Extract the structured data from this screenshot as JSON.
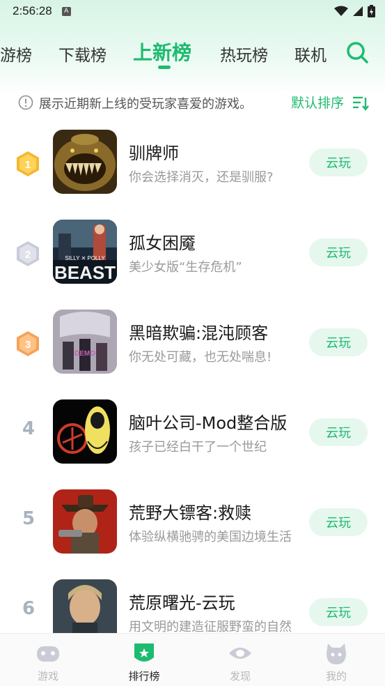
{
  "status_bar": {
    "time": "2:56:28",
    "notification_glyph": "A"
  },
  "tabs": [
    {
      "label": "游榜",
      "active": false
    },
    {
      "label": "下载榜",
      "active": false
    },
    {
      "label": "上新榜",
      "active": true
    },
    {
      "label": "热玩榜",
      "active": false
    },
    {
      "label": "联机",
      "active": false
    }
  ],
  "info": {
    "text": "展示近期新上线的受玩家喜爱的游戏。",
    "sort_label": "默认排序"
  },
  "games": [
    {
      "rank": "1",
      "title": "驯牌师",
      "desc": "你会选择消灭，还是驯服?",
      "button": "云玩",
      "medal": "gold"
    },
    {
      "rank": "2",
      "title": "孤女困魇",
      "desc": "美少女版“生存危机”",
      "button": "云玩",
      "medal": "silver"
    },
    {
      "rank": "3",
      "title": "黑暗欺骗:混沌顾客",
      "desc": "你无处可藏，也无处喘息!",
      "button": "云玩",
      "medal": "bronze"
    },
    {
      "rank": "4",
      "title": "脑叶公司-Mod整合版",
      "desc": "孩子已经白干了一个世纪",
      "button": "云玩",
      "medal": "none"
    },
    {
      "rank": "5",
      "title": "荒野大镖客:救赎",
      "desc": "体验纵横驰骋的美国边境生活",
      "button": "云玩",
      "medal": "none"
    },
    {
      "rank": "6",
      "title": "荒原曙光-云玩",
      "desc": "用文明的建造征服野蛮的自然",
      "button": "云玩",
      "medal": "none"
    }
  ],
  "thumb_text": {
    "beast_small": "SILLY ✕ POLLY",
    "beast_big": "BEAST",
    "demo": "DEMO"
  },
  "bottom_nav": [
    {
      "label": "游戏",
      "icon": "gamepad-icon",
      "active": false
    },
    {
      "label": "排行榜",
      "icon": "ranking-shield-icon",
      "active": true
    },
    {
      "label": "发现",
      "icon": "eye-icon",
      "active": false
    },
    {
      "label": "我的",
      "icon": "profile-face-icon",
      "active": false
    }
  ],
  "colors": {
    "accent": "#1dbb6f",
    "button_bg": "#e6f7ee",
    "gold": "#f5b731",
    "silver": "#c9ccd6",
    "bronze": "#f3a35c"
  }
}
